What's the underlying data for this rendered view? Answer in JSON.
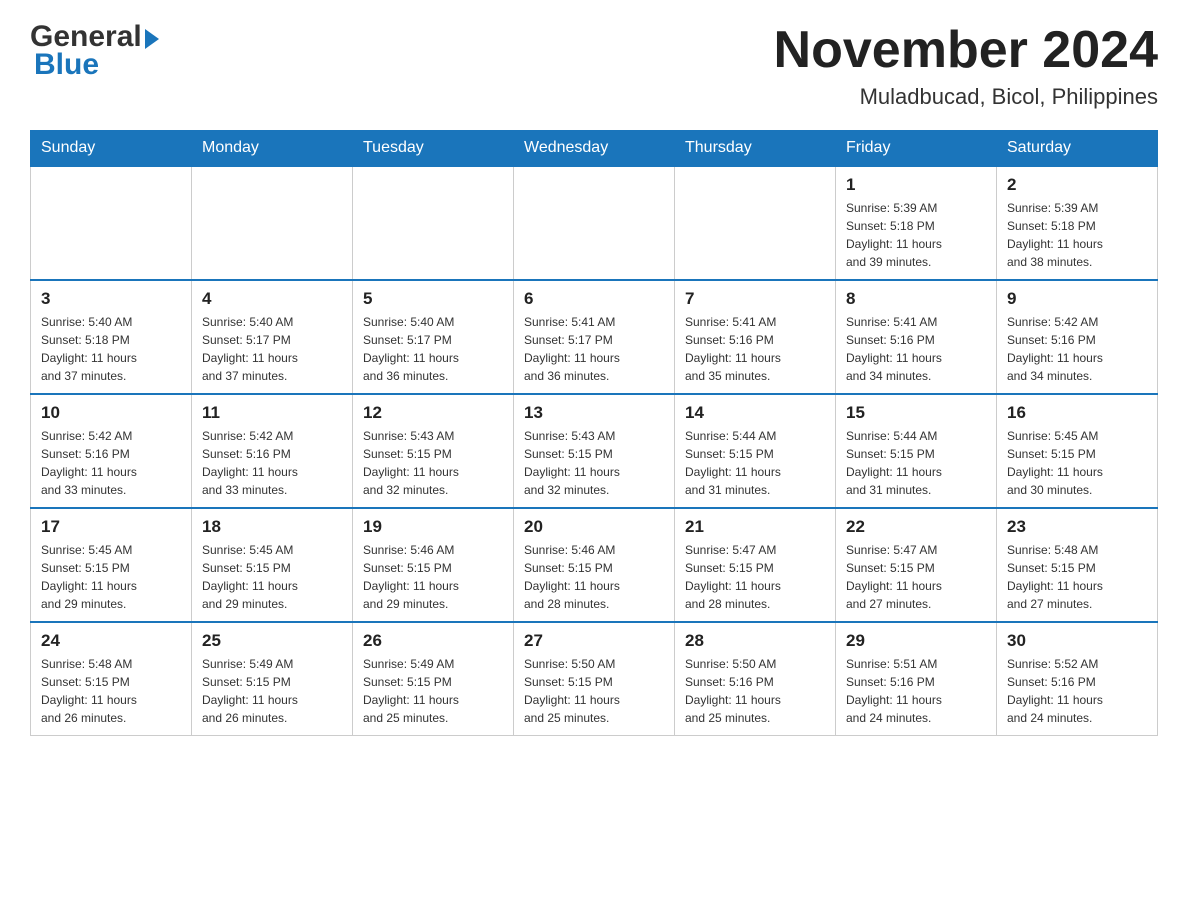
{
  "header": {
    "logo_general": "General",
    "logo_blue": "Blue",
    "month_title": "November 2024",
    "location": "Muladbucad, Bicol, Philippines"
  },
  "days_of_week": [
    "Sunday",
    "Monday",
    "Tuesday",
    "Wednesday",
    "Thursday",
    "Friday",
    "Saturday"
  ],
  "weeks": [
    [
      {
        "day": "",
        "info": ""
      },
      {
        "day": "",
        "info": ""
      },
      {
        "day": "",
        "info": ""
      },
      {
        "day": "",
        "info": ""
      },
      {
        "day": "",
        "info": ""
      },
      {
        "day": "1",
        "info": "Sunrise: 5:39 AM\nSunset: 5:18 PM\nDaylight: 11 hours\nand 39 minutes."
      },
      {
        "day": "2",
        "info": "Sunrise: 5:39 AM\nSunset: 5:18 PM\nDaylight: 11 hours\nand 38 minutes."
      }
    ],
    [
      {
        "day": "3",
        "info": "Sunrise: 5:40 AM\nSunset: 5:18 PM\nDaylight: 11 hours\nand 37 minutes."
      },
      {
        "day": "4",
        "info": "Sunrise: 5:40 AM\nSunset: 5:17 PM\nDaylight: 11 hours\nand 37 minutes."
      },
      {
        "day": "5",
        "info": "Sunrise: 5:40 AM\nSunset: 5:17 PM\nDaylight: 11 hours\nand 36 minutes."
      },
      {
        "day": "6",
        "info": "Sunrise: 5:41 AM\nSunset: 5:17 PM\nDaylight: 11 hours\nand 36 minutes."
      },
      {
        "day": "7",
        "info": "Sunrise: 5:41 AM\nSunset: 5:16 PM\nDaylight: 11 hours\nand 35 minutes."
      },
      {
        "day": "8",
        "info": "Sunrise: 5:41 AM\nSunset: 5:16 PM\nDaylight: 11 hours\nand 34 minutes."
      },
      {
        "day": "9",
        "info": "Sunrise: 5:42 AM\nSunset: 5:16 PM\nDaylight: 11 hours\nand 34 minutes."
      }
    ],
    [
      {
        "day": "10",
        "info": "Sunrise: 5:42 AM\nSunset: 5:16 PM\nDaylight: 11 hours\nand 33 minutes."
      },
      {
        "day": "11",
        "info": "Sunrise: 5:42 AM\nSunset: 5:16 PM\nDaylight: 11 hours\nand 33 minutes."
      },
      {
        "day": "12",
        "info": "Sunrise: 5:43 AM\nSunset: 5:15 PM\nDaylight: 11 hours\nand 32 minutes."
      },
      {
        "day": "13",
        "info": "Sunrise: 5:43 AM\nSunset: 5:15 PM\nDaylight: 11 hours\nand 32 minutes."
      },
      {
        "day": "14",
        "info": "Sunrise: 5:44 AM\nSunset: 5:15 PM\nDaylight: 11 hours\nand 31 minutes."
      },
      {
        "day": "15",
        "info": "Sunrise: 5:44 AM\nSunset: 5:15 PM\nDaylight: 11 hours\nand 31 minutes."
      },
      {
        "day": "16",
        "info": "Sunrise: 5:45 AM\nSunset: 5:15 PM\nDaylight: 11 hours\nand 30 minutes."
      }
    ],
    [
      {
        "day": "17",
        "info": "Sunrise: 5:45 AM\nSunset: 5:15 PM\nDaylight: 11 hours\nand 29 minutes."
      },
      {
        "day": "18",
        "info": "Sunrise: 5:45 AM\nSunset: 5:15 PM\nDaylight: 11 hours\nand 29 minutes."
      },
      {
        "day": "19",
        "info": "Sunrise: 5:46 AM\nSunset: 5:15 PM\nDaylight: 11 hours\nand 29 minutes."
      },
      {
        "day": "20",
        "info": "Sunrise: 5:46 AM\nSunset: 5:15 PM\nDaylight: 11 hours\nand 28 minutes."
      },
      {
        "day": "21",
        "info": "Sunrise: 5:47 AM\nSunset: 5:15 PM\nDaylight: 11 hours\nand 28 minutes."
      },
      {
        "day": "22",
        "info": "Sunrise: 5:47 AM\nSunset: 5:15 PM\nDaylight: 11 hours\nand 27 minutes."
      },
      {
        "day": "23",
        "info": "Sunrise: 5:48 AM\nSunset: 5:15 PM\nDaylight: 11 hours\nand 27 minutes."
      }
    ],
    [
      {
        "day": "24",
        "info": "Sunrise: 5:48 AM\nSunset: 5:15 PM\nDaylight: 11 hours\nand 26 minutes."
      },
      {
        "day": "25",
        "info": "Sunrise: 5:49 AM\nSunset: 5:15 PM\nDaylight: 11 hours\nand 26 minutes."
      },
      {
        "day": "26",
        "info": "Sunrise: 5:49 AM\nSunset: 5:15 PM\nDaylight: 11 hours\nand 25 minutes."
      },
      {
        "day": "27",
        "info": "Sunrise: 5:50 AM\nSunset: 5:15 PM\nDaylight: 11 hours\nand 25 minutes."
      },
      {
        "day": "28",
        "info": "Sunrise: 5:50 AM\nSunset: 5:16 PM\nDaylight: 11 hours\nand 25 minutes."
      },
      {
        "day": "29",
        "info": "Sunrise: 5:51 AM\nSunset: 5:16 PM\nDaylight: 11 hours\nand 24 minutes."
      },
      {
        "day": "30",
        "info": "Sunrise: 5:52 AM\nSunset: 5:16 PM\nDaylight: 11 hours\nand 24 minutes."
      }
    ]
  ]
}
